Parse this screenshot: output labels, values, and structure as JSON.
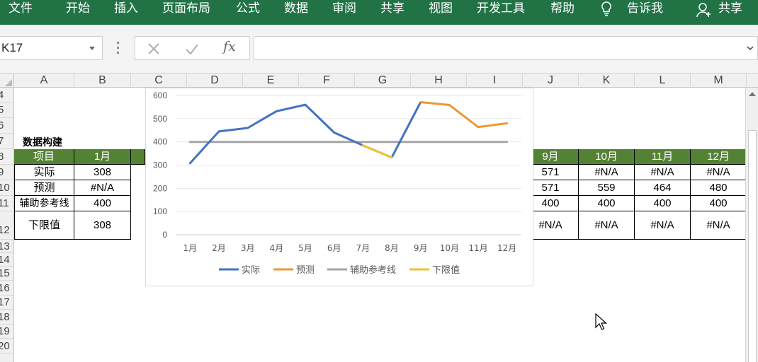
{
  "ribbon": {
    "tabs": [
      "文件",
      "开始",
      "插入",
      "页面布局",
      "公式",
      "数据",
      "审阅",
      "共享",
      "视图",
      "开发工具",
      "帮助"
    ],
    "tell_me": "告诉我",
    "share": "共享"
  },
  "formula_bar": {
    "name_box": "K17",
    "cancel_icon": "close-icon",
    "enter_icon": "check-icon",
    "fx_label": "fx",
    "content": ""
  },
  "columns": [
    "A",
    "B",
    "C",
    "D",
    "E",
    "F",
    "G",
    "H",
    "I",
    "J",
    "K",
    "L",
    "M"
  ],
  "rows": [
    "4",
    "5",
    "6",
    "7",
    "8",
    "9",
    "10",
    "11",
    "12",
    "13",
    "14",
    "15",
    "16",
    "17",
    "18",
    "19",
    "20"
  ],
  "sheet": {
    "title": "数据构建",
    "header": {
      "label": "项目",
      "months_left": [
        "1月"
      ],
      "months_right": [
        "9月",
        "10月",
        "11月",
        "12月"
      ]
    },
    "rows": [
      {
        "label": "实际",
        "b": "308",
        "right": [
          "571",
          "#N/A",
          "#N/A",
          "#N/A"
        ]
      },
      {
        "label": "预测",
        "b": "#N/A",
        "right": [
          "571",
          "559",
          "464",
          "480"
        ]
      },
      {
        "label": "辅助参考线",
        "b": "400",
        "right": [
          "400",
          "400",
          "400",
          "400"
        ]
      },
      {
        "label": "下限值",
        "b": "308",
        "right": [
          "#N/A",
          "#N/A",
          "#N/A",
          "#N/A"
        ]
      }
    ],
    "header_fill": "#548235"
  },
  "chart_data": {
    "type": "line",
    "categories": [
      "1月",
      "2月",
      "3月",
      "4月",
      "5月",
      "6月",
      "7月",
      "8月",
      "9月",
      "10月",
      "11月",
      "12月"
    ],
    "ylim": [
      0,
      600
    ],
    "yticks": [
      "0",
      "100",
      "200",
      "300",
      "400",
      "500",
      "600"
    ],
    "grid": true,
    "legend_position": "bottom",
    "series": [
      {
        "name": "实际",
        "color": "#4472C4",
        "values": [
          308,
          445,
          460,
          532,
          560,
          440,
          385,
          333,
          571,
          null,
          null,
          null
        ]
      },
      {
        "name": "预测",
        "color": "#ED9734",
        "values": [
          null,
          null,
          null,
          null,
          null,
          null,
          null,
          null,
          571,
          559,
          464,
          480
        ]
      },
      {
        "name": "辅助参考线",
        "color": "#A5A5A5",
        "values": [
          400,
          400,
          400,
          400,
          400,
          400,
          400,
          400,
          400,
          400,
          400,
          400
        ]
      },
      {
        "name": "下限值",
        "color": "#F2C230",
        "values": [
          null,
          null,
          null,
          null,
          null,
          null,
          385,
          333,
          null,
          null,
          null,
          null
        ]
      }
    ]
  }
}
